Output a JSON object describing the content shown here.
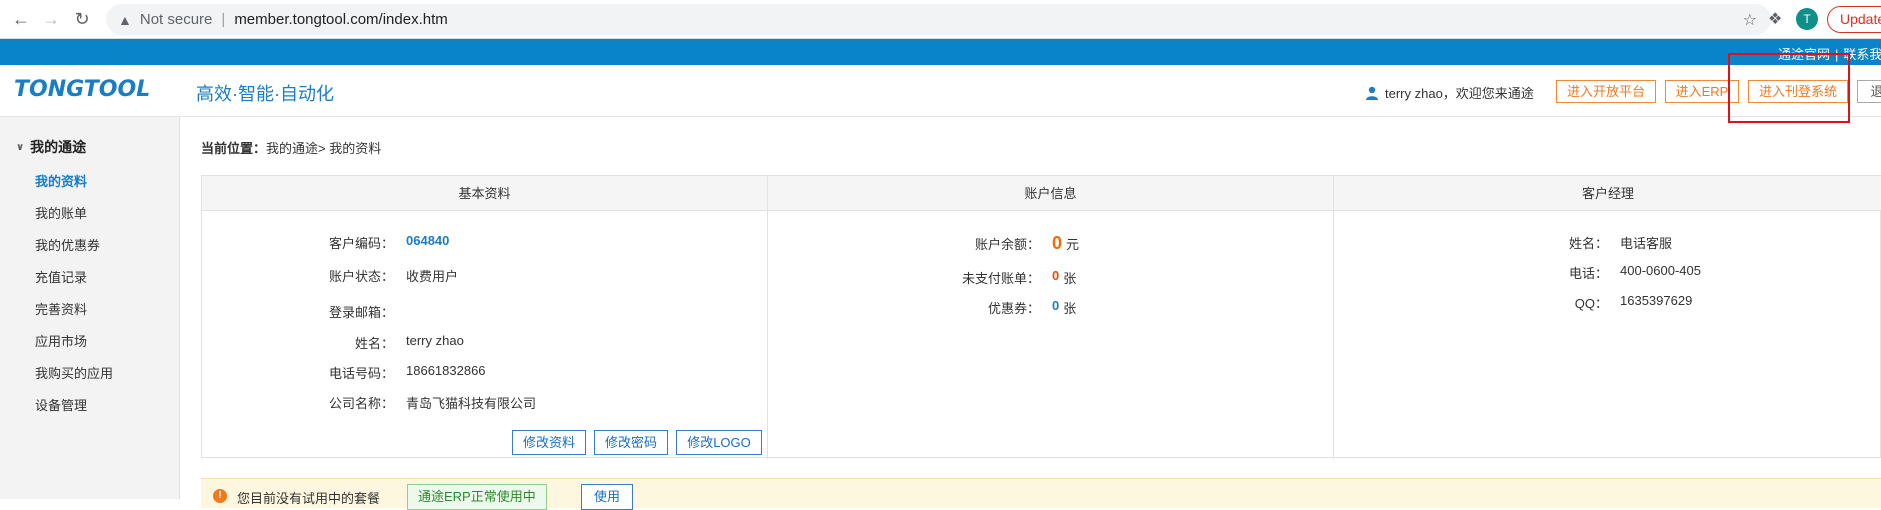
{
  "browser": {
    "security_label": "Not secure",
    "url": "member.tongtool.com/index.htm",
    "profile_initial": "T",
    "update_label": "Update"
  },
  "topbar": {
    "links": [
      "通途官网",
      "联系我"
    ]
  },
  "header": {
    "logo": "TONGTOOL",
    "slogan": "高效·智能·自动化",
    "greeting": "terry zhao，欢迎您来通途",
    "buttons": [
      "进入开放平台",
      "进入ERP",
      "进入刊登系统",
      "退"
    ]
  },
  "sidebar": {
    "group": "我的通途",
    "items": [
      "我的资料",
      "我的账单",
      "我的优惠券",
      "充值记录",
      "完善资料",
      "应用市场",
      "我购买的应用",
      "设备管理"
    ]
  },
  "breadcrumb": {
    "label": "当前位置：",
    "path": "我的通途> 我的资料"
  },
  "basic": {
    "title": "基本资料",
    "fields": [
      {
        "label": "客户编码：",
        "value": "064840"
      },
      {
        "label": "账户状态：",
        "value": "收费用户"
      },
      {
        "label": "登录邮箱：",
        "value": ""
      },
      {
        "label": "姓名：",
        "value": "terry zhao"
      },
      {
        "label": "电话号码：",
        "value": "18661832866"
      },
      {
        "label": "公司名称：",
        "value": "青岛飞猫科技有限公司"
      }
    ],
    "buttons": [
      "修改资料",
      "修改密码",
      "修改LOGO"
    ]
  },
  "account": {
    "title": "账户信息",
    "balance_label": "账户余额：",
    "balance_value": "0",
    "balance_unit": "元",
    "unpaid_label": "未支付账单：",
    "unpaid_value": "0",
    "unpaid_unit": "张",
    "coupon_label": "优惠券：",
    "coupon_value": "0",
    "coupon_unit": "张"
  },
  "manager": {
    "title": "客户经理",
    "name_label": "姓名：",
    "name_value": "电话客服",
    "phone_label": "电话：",
    "phone_value": "400-0600-405",
    "qq_label": "QQ：",
    "qq_value": "1635397629"
  },
  "notice": {
    "text": "您目前没有试用中的套餐",
    "tag": "通途ERP正常使用中",
    "use_button": "使用"
  }
}
